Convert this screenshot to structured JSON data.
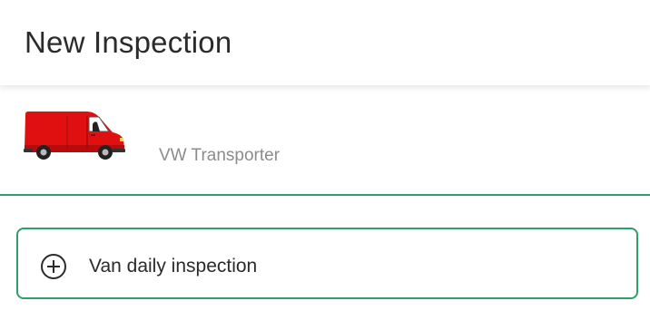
{
  "header": {
    "title": "New Inspection"
  },
  "vehicle": {
    "name": "VW Transporter",
    "image_icon": "red-van-icon",
    "image_color": "#e01010"
  },
  "inspection_action": {
    "label": "Van daily inspection",
    "icon": "plus-circle-icon"
  },
  "colors": {
    "accent": "#2f9e68",
    "title_text": "#2b2b2b",
    "secondary_text": "#8c8c8c"
  }
}
